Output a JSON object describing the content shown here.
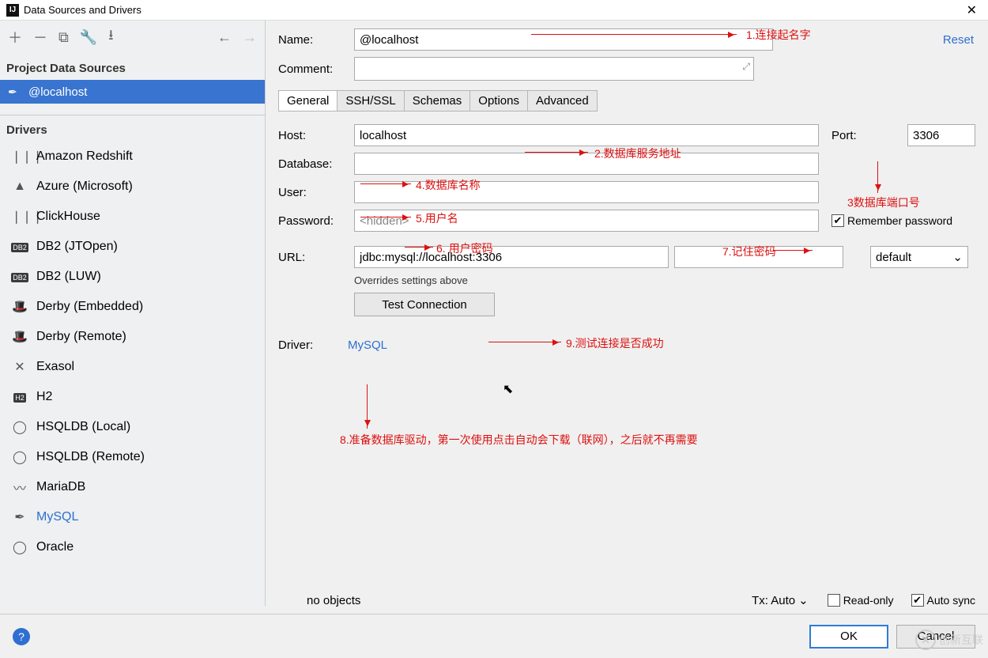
{
  "window": {
    "title": "Data Sources and Drivers"
  },
  "left": {
    "project_title": "Project Data Sources",
    "datasource": "@localhost",
    "drivers_title": "Drivers",
    "drivers": [
      "Amazon Redshift",
      "Azure (Microsoft)",
      "ClickHouse",
      "DB2 (JTOpen)",
      "DB2 (LUW)",
      "Derby (Embedded)",
      "Derby (Remote)",
      "Exasol",
      "H2",
      "HSQLDB (Local)",
      "HSQLDB (Remote)",
      "MariaDB",
      "MySQL",
      "Oracle"
    ],
    "active_driver": "MySQL"
  },
  "form": {
    "name_label": "Name:",
    "name_value": "@localhost",
    "reset": "Reset",
    "comment_label": "Comment:",
    "tabs": [
      "General",
      "SSH/SSL",
      "Schemas",
      "Options",
      "Advanced"
    ],
    "host_label": "Host:",
    "host_value": "localhost",
    "port_label": "Port:",
    "port_value": "3306",
    "database_label": "Database:",
    "user_label": "User:",
    "password_label": "Password:",
    "password_placeholder": "<hidden>",
    "remember_label": "Remember password",
    "remember_checked": true,
    "url_label": "URL:",
    "url_value": "jdbc:mysql://localhost:3306",
    "url_mode": "default",
    "override_note": "Overrides settings above",
    "test_btn": "Test Connection",
    "driver_label": "Driver:",
    "driver_link": "MySQL"
  },
  "bottom": {
    "noobj": "no objects",
    "tx": "Tx: Auto",
    "readonly": "Read-only",
    "readonly_checked": false,
    "autosync": "Auto sync",
    "autosync_checked": true
  },
  "footer": {
    "ok": "OK",
    "cancel": "Cancel"
  },
  "annotations": {
    "a1": "1.连接起名字",
    "a2": "2.数据库服务地址",
    "a3": "3数据库端口号",
    "a4": "4.数据库名称",
    "a5": "5.用户名",
    "a6": "6. 用户密码",
    "a7": "7.记住密码",
    "a8": "8.准备数据库驱动，第一次使用点击自动会下载（联网），之后就不再需要",
    "a9": "9.测试连接是否成功"
  },
  "watermark": {
    "brand": "创新互联"
  }
}
